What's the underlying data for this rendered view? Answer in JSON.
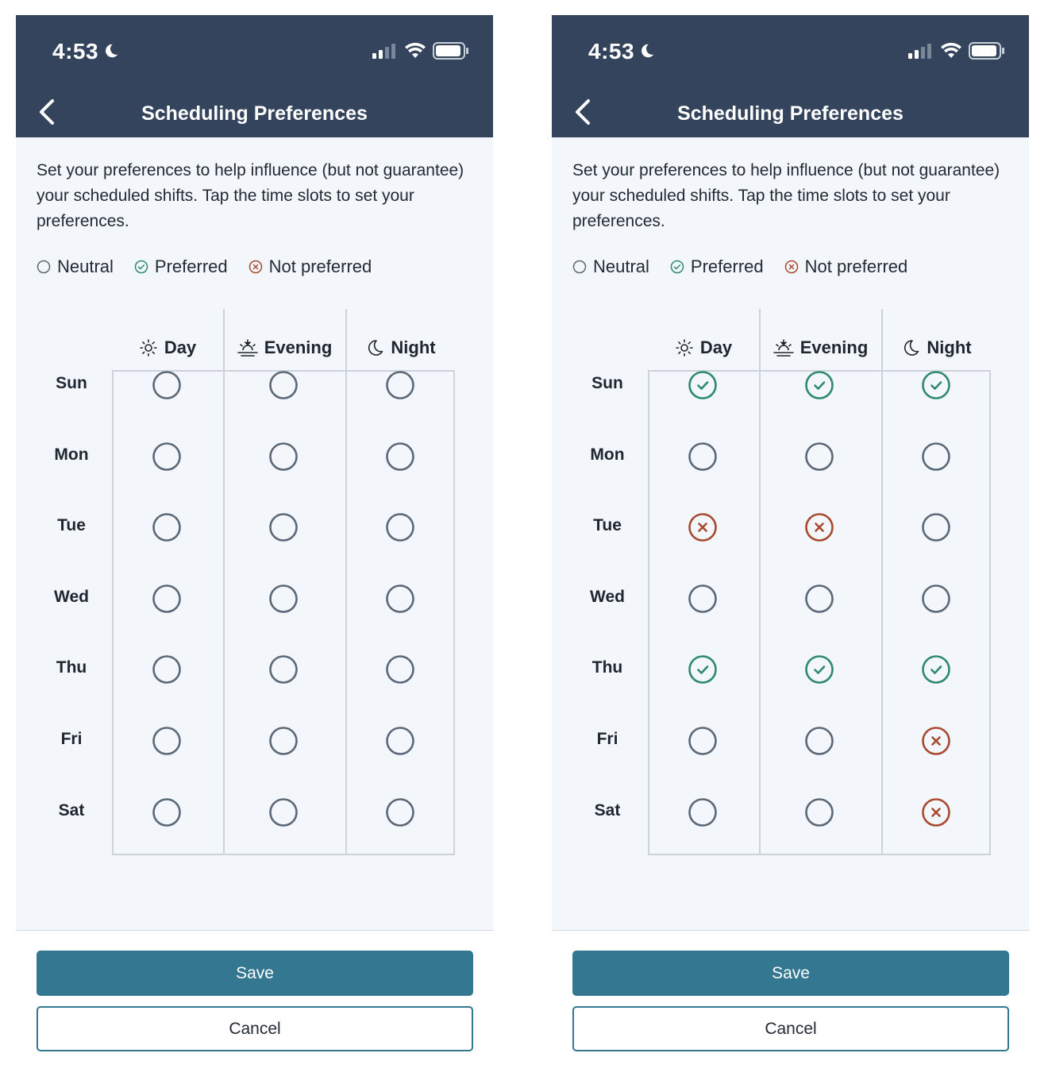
{
  "status_bar": {
    "time": "4:53"
  },
  "header": {
    "title": "Scheduling Preferences"
  },
  "intro_text": "Set your preferences to help influence (but not guarantee) your scheduled shifts. Tap the time slots to set your preferences.",
  "legend": {
    "neutral": "Neutral",
    "preferred": "Preferred",
    "not_preferred": "Not preferred"
  },
  "columns": [
    {
      "label": "Day",
      "icon": "sun-icon"
    },
    {
      "label": "Evening",
      "icon": "sunset-icon"
    },
    {
      "label": "Night",
      "icon": "moon-icon"
    }
  ],
  "days": [
    "Sun",
    "Mon",
    "Tue",
    "Wed",
    "Thu",
    "Fri",
    "Sat"
  ],
  "buttons": {
    "save": "Save",
    "cancel": "Cancel"
  },
  "colors": {
    "header": "#34445c",
    "preferred": "#2e8a6d",
    "not_preferred": "#a9492f",
    "neutral": "#5a6878",
    "button": "#337791"
  },
  "screens": [
    {
      "name": "before",
      "grid": [
        [
          "neutral",
          "neutral",
          "neutral"
        ],
        [
          "neutral",
          "neutral",
          "neutral"
        ],
        [
          "neutral",
          "neutral",
          "neutral"
        ],
        [
          "neutral",
          "neutral",
          "neutral"
        ],
        [
          "neutral",
          "neutral",
          "neutral"
        ],
        [
          "neutral",
          "neutral",
          "neutral"
        ],
        [
          "neutral",
          "neutral",
          "neutral"
        ]
      ]
    },
    {
      "name": "after",
      "grid": [
        [
          "preferred",
          "preferred",
          "preferred"
        ],
        [
          "neutral",
          "neutral",
          "neutral"
        ],
        [
          "not_preferred",
          "not_preferred",
          "neutral"
        ],
        [
          "neutral",
          "neutral",
          "neutral"
        ],
        [
          "preferred",
          "preferred",
          "preferred"
        ],
        [
          "neutral",
          "neutral",
          "not_preferred"
        ],
        [
          "neutral",
          "neutral",
          "not_preferred"
        ]
      ]
    }
  ]
}
